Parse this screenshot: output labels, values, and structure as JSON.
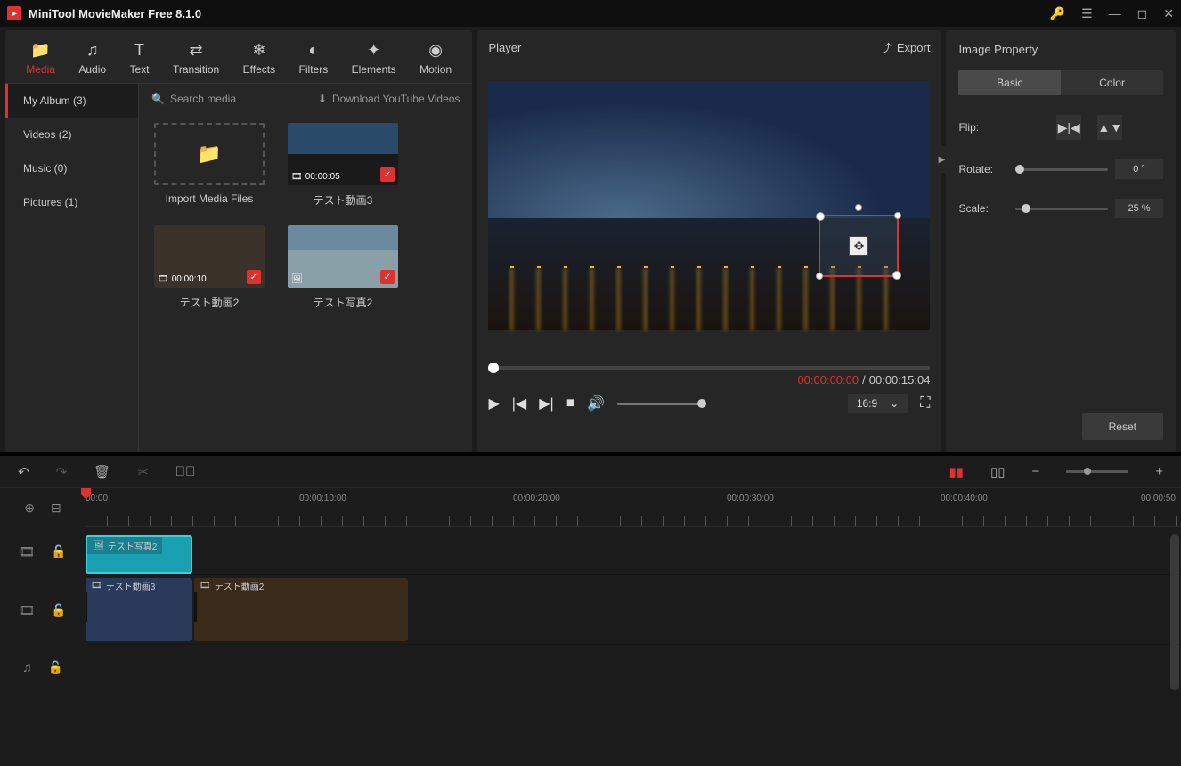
{
  "app": {
    "title": "MiniTool MovieMaker Free 8.1.0"
  },
  "tool_tabs": [
    {
      "label": "Media",
      "icon": "folder"
    },
    {
      "label": "Audio",
      "icon": "music"
    },
    {
      "label": "Text",
      "icon": "text"
    },
    {
      "label": "Transition",
      "icon": "swap"
    },
    {
      "label": "Effects",
      "icon": "fx"
    },
    {
      "label": "Filters",
      "icon": "filter"
    },
    {
      "label": "Elements",
      "icon": "star"
    },
    {
      "label": "Motion",
      "icon": "motion"
    }
  ],
  "library": {
    "categories": [
      {
        "label": "My Album (3)",
        "active": true
      },
      {
        "label": "Videos (2)"
      },
      {
        "label": "Music (0)"
      },
      {
        "label": "Pictures (1)"
      }
    ],
    "search_placeholder": "Search media",
    "download_label": "Download YouTube Videos",
    "import_label": "Import Media Files",
    "items": [
      {
        "name": "テスト動画3",
        "duration": "00:00:05",
        "type": "video",
        "used": true
      },
      {
        "name": "テスト動画2",
        "duration": "00:00:10",
        "type": "video",
        "used": true
      },
      {
        "name": "テスト写真2",
        "duration": "",
        "type": "image",
        "used": true
      }
    ]
  },
  "player": {
    "title": "Player",
    "export_label": "Export",
    "current_time": "00:00:00:00",
    "total_time": "00:00:15:04",
    "aspect_ratio": "16:9"
  },
  "props": {
    "title": "Image Property",
    "tabs": {
      "basic": "Basic",
      "color": "Color"
    },
    "flip_label": "Flip:",
    "rotate_label": "Rotate:",
    "rotate_value": "0 °",
    "scale_label": "Scale:",
    "scale_value": "25 %",
    "reset_label": "Reset"
  },
  "timeline": {
    "ruler": [
      "00:00",
      "00:00:10:00",
      "00:00:20:00",
      "00:00:30:00",
      "00:00:40:00",
      "00:00:50"
    ],
    "overlay_clip": {
      "label": "テスト写真2"
    },
    "video_clips": [
      {
        "label": "テスト動画3"
      },
      {
        "label": "テスト動画2"
      }
    ]
  }
}
